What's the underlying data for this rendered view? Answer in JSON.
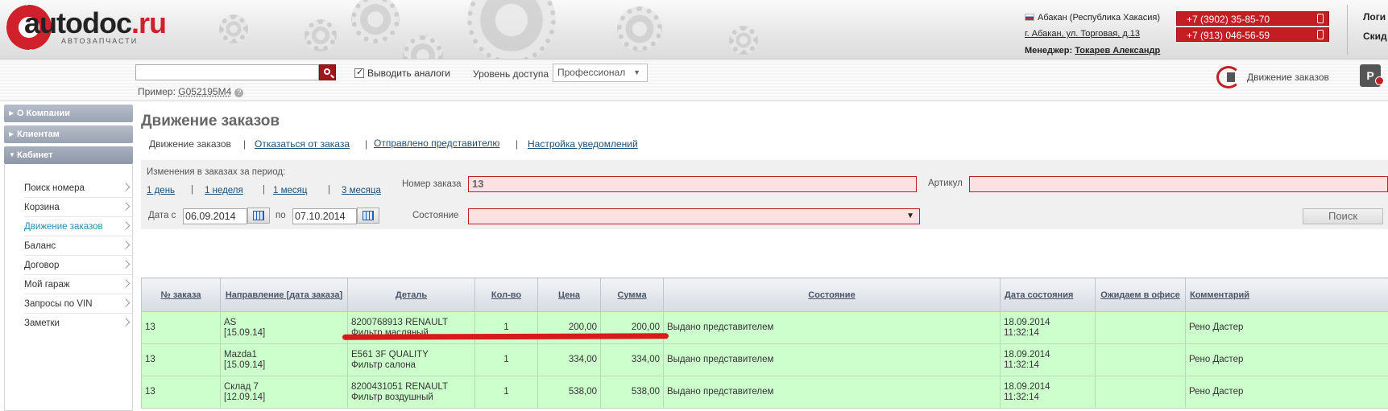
{
  "header": {
    "logo_main": "autodoc",
    "logo_tld": ".ru",
    "logo_sub": "АВТОЗАПЧАСТИ",
    "region": "Абакан (Республика Хакасия)",
    "address": "г. Абакан, ул. Торговая, д.13",
    "manager_label": "Менеджер:",
    "manager_name": "Токарев Александр",
    "phone1": "+7 (3902) 35-85-70",
    "phone2": "+7 (913) 046-56-59",
    "login": "Логи",
    "discount": "Скид"
  },
  "searchbar": {
    "query": "",
    "show_analogs_label": "Выводить аналоги",
    "show_analogs_checked": true,
    "access_label": "Уровень доступа",
    "access_value": "Профессионал",
    "example_label": "Пример:",
    "example_code": "G052195M4",
    "orders_link": "Движение заказов"
  },
  "sidebar": {
    "sections": [
      "О Компании",
      "Клиентам",
      "Кабинет"
    ],
    "items": [
      {
        "label": "Поиск номера"
      },
      {
        "label": "Корзина"
      },
      {
        "label": "Движение заказов",
        "active": true
      },
      {
        "label": "Баланс"
      },
      {
        "label": "Договор"
      },
      {
        "label": "Мой гараж"
      },
      {
        "label": "Запросы по VIN"
      },
      {
        "label": "Заметки"
      }
    ]
  },
  "main": {
    "title": "Движение заказов",
    "tabs": [
      "Движение заказов",
      "Отказаться от заказа",
      "Отправлено представителю",
      "Настройка уведомлений"
    ]
  },
  "filter": {
    "period_label": "Изменения в заказах за период:",
    "periods": [
      "1 день",
      "1 неделя",
      "1 месяц",
      "3 месяца"
    ],
    "date_from_label": "Дата с",
    "date_from": "06.09.2014",
    "date_to_label": "по",
    "date_to": "07.10.2014",
    "order_no_label": "Номер заказа",
    "order_no": "13",
    "article_label": "Артикул",
    "article": "",
    "state_label": "Состояние",
    "state_value": "",
    "search_button": "Поиск"
  },
  "table": {
    "headers": [
      "№ заказа",
      "Направление [дата заказа]",
      "Деталь",
      "Кол-во",
      "Цена",
      "Сумма",
      "Состояние",
      "Дата состояния",
      "Ожидаем в офисе",
      "Комментарий"
    ],
    "rows": [
      {
        "order": "13",
        "dir": "AS",
        "dir_date": "[15.09.14]",
        "part_code": "8200768913 RENAULT",
        "part_name": "Фильтр масляный",
        "qty": "1",
        "price": "200,00",
        "sum": "200,00",
        "state": "Выдано представителем",
        "state_date": "18.09.2014",
        "state_time": "11:32:14",
        "expected": "",
        "comment": "Рено Дастер"
      },
      {
        "order": "13",
        "dir": "Mazda1",
        "dir_date": "[15.09.14]",
        "part_code": "E561 3F QUALITY",
        "part_name": "Фильтр салона",
        "qty": "1",
        "price": "334,00",
        "sum": "334,00",
        "state": "Выдано представителем",
        "state_date": "18.09.2014",
        "state_time": "11:32:14",
        "expected": "",
        "comment": "Рено Дастер"
      },
      {
        "order": "13",
        "dir": "Склад 7",
        "dir_date": "[12.09.14]",
        "part_code": "8200431051 RENAULT",
        "part_name": "Фильтр воздушный",
        "qty": "1",
        "price": "538,00",
        "sum": "538,00",
        "state": "Выдано представителем",
        "state_date": "18.09.2014",
        "state_time": "11:32:14",
        "expected": "",
        "comment": "Рено Дастер"
      }
    ]
  },
  "colors": {
    "brand_red": "#c41e25",
    "row_green": "#ccffcc",
    "link_blue": "#1c4f77",
    "annotation_red": "#d71a1a"
  }
}
